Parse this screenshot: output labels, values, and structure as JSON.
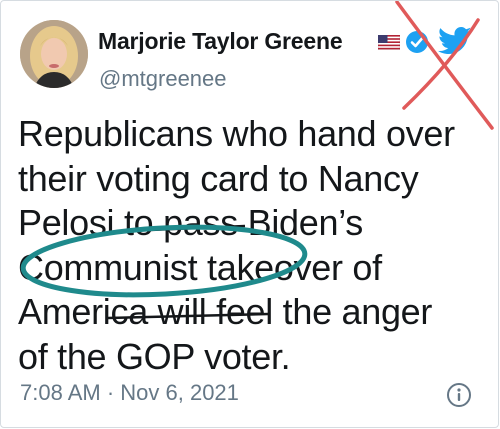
{
  "tweet": {
    "author": {
      "display_name": "Marjorie Taylor Greene",
      "handle": "@mtgreenee",
      "avatar": "profile-photo",
      "flag": "us-flag-icon",
      "verified": "verified-badge-icon"
    },
    "brand_icon": "twitter-bird-icon",
    "text_lines": [
      "Republicans who hand over",
      "their voting card to Nancy",
      "Pelosi to pass Biden’s",
      "Communist takeover of",
      "America will feel the anger",
      "of the GOP voter."
    ],
    "timestamp": "7:08 AM · Nov 6, 2021",
    "info_icon": "info-icon"
  },
  "annotations": {
    "cross_color": "#e05a5a",
    "ellipse_color": "#1f8a8c"
  },
  "colors": {
    "text": "#14171a",
    "secondary": "#657786",
    "twitter_blue": "#1da1f2"
  }
}
